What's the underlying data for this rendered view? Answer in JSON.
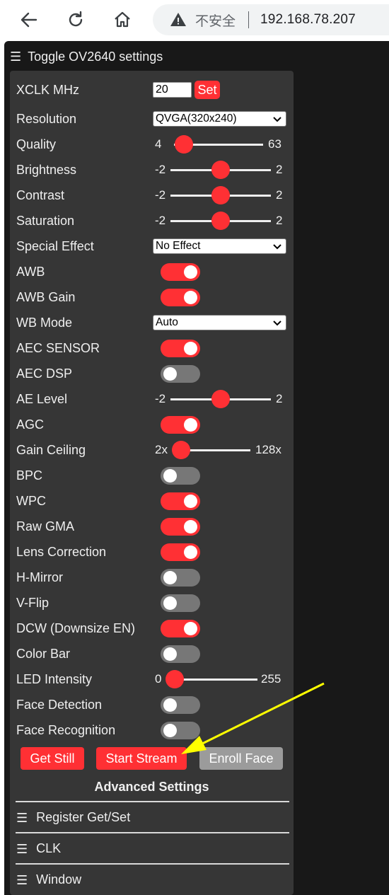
{
  "browser": {
    "insecure_label": "不安全",
    "url": "192.168.78.207"
  },
  "page": {
    "toggle_header": "Toggle OV2640 settings",
    "xclk": {
      "label": "XCLK MHz",
      "value": "20",
      "set_label": "Set"
    },
    "resolution": {
      "label": "Resolution",
      "selected": "QVGA(320x240)"
    },
    "quality": {
      "label": "Quality",
      "min": "4",
      "max": "63",
      "value": 10
    },
    "brightness": {
      "label": "Brightness",
      "min": "-2",
      "max": "2",
      "value": 0
    },
    "contrast": {
      "label": "Contrast",
      "min": "-2",
      "max": "2",
      "value": 0
    },
    "saturation": {
      "label": "Saturation",
      "min": "-2",
      "max": "2",
      "value": 0
    },
    "special_effect": {
      "label": "Special Effect",
      "selected": "No Effect"
    },
    "awb": {
      "label": "AWB",
      "on": true
    },
    "awb_gain": {
      "label": "AWB Gain",
      "on": true
    },
    "wb_mode": {
      "label": "WB Mode",
      "selected": "Auto"
    },
    "aec_sensor": {
      "label": "AEC SENSOR",
      "on": true
    },
    "aec_dsp": {
      "label": "AEC DSP",
      "on": false
    },
    "ae_level": {
      "label": "AE Level",
      "min": "-2",
      "max": "2",
      "value": 0
    },
    "agc": {
      "label": "AGC",
      "on": true
    },
    "gain_ceiling": {
      "label": "Gain Ceiling",
      "min": "2x",
      "max": "128x",
      "value": 0
    },
    "bpc": {
      "label": "BPC",
      "on": false
    },
    "wpc": {
      "label": "WPC",
      "on": true
    },
    "raw_gma": {
      "label": "Raw GMA",
      "on": true
    },
    "lens_correction": {
      "label": "Lens Correction",
      "on": true
    },
    "hmirror": {
      "label": "H-Mirror",
      "on": false
    },
    "vflip": {
      "label": "V-Flip",
      "on": false
    },
    "dcw": {
      "label": "DCW (Downsize EN)",
      "on": true
    },
    "colorbar": {
      "label": "Color Bar",
      "on": false
    },
    "led_intensity": {
      "label": "LED Intensity",
      "min": "0",
      "max": "255",
      "value": 0
    },
    "face_detection": {
      "label": "Face Detection",
      "on": false
    },
    "face_recognition": {
      "label": "Face Recognition",
      "on": false
    },
    "buttons": {
      "get_still": "Get Still",
      "start_stream": "Start Stream",
      "enroll_face": "Enroll Face"
    },
    "advanced_title": "Advanced Settings",
    "sections": [
      "Register Get/Set",
      "CLK",
      "Window"
    ]
  },
  "colors": {
    "accent": "#ff3034",
    "panel": "#363636",
    "background": "#181818",
    "switch_off": "#777777",
    "arrow": "#ffff00"
  }
}
